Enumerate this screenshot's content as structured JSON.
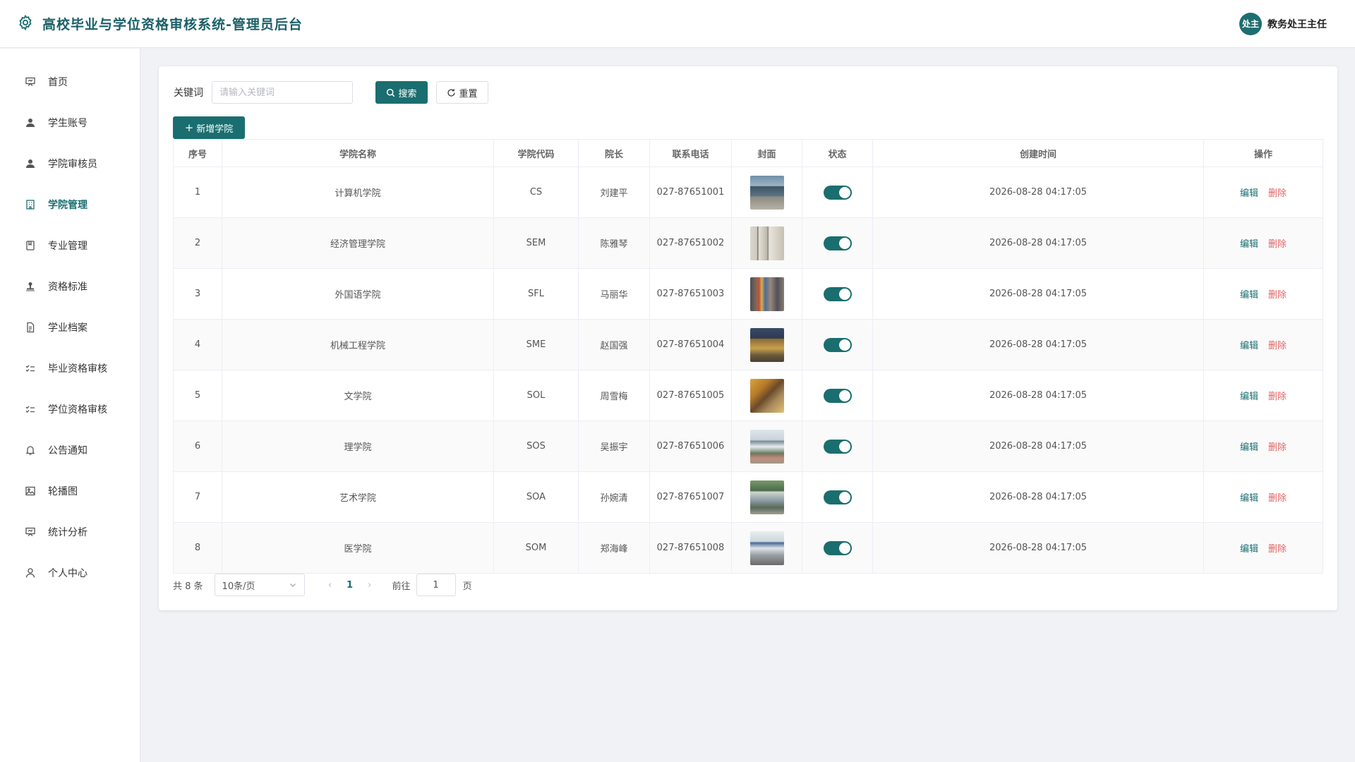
{
  "header": {
    "title": "高校毕业与学位资格审核系统-管理员后台",
    "avatar_text": "处主",
    "user_name": "教务处王主任"
  },
  "sidebar": {
    "items": [
      {
        "label": "首页",
        "icon": "presentation-icon",
        "active": false
      },
      {
        "label": "学生账号",
        "icon": "user-icon",
        "active": false
      },
      {
        "label": "学院审核员",
        "icon": "user-icon",
        "active": false
      },
      {
        "label": "学院管理",
        "icon": "building-icon",
        "active": true
      },
      {
        "label": "专业管理",
        "icon": "notebook-icon",
        "active": false
      },
      {
        "label": "资格标准",
        "icon": "stamp-icon",
        "active": false
      },
      {
        "label": "学业档案",
        "icon": "document-icon",
        "active": false
      },
      {
        "label": "毕业资格审核",
        "icon": "checklist-icon",
        "active": false
      },
      {
        "label": "学位资格审核",
        "icon": "checklist-icon",
        "active": false
      },
      {
        "label": "公告通知",
        "icon": "bell-icon",
        "active": false
      },
      {
        "label": "轮播图",
        "icon": "picture-icon",
        "active": false
      },
      {
        "label": "统计分析",
        "icon": "presentation-icon",
        "active": false
      },
      {
        "label": "个人中心",
        "icon": "person-outline-icon",
        "active": false
      }
    ]
  },
  "search": {
    "label": "关键词",
    "placeholder": "请输入关键词",
    "value": "",
    "search_label": "搜索",
    "reset_label": "重置"
  },
  "toolbar": {
    "add_label": "新增学院"
  },
  "table": {
    "headers": [
      "序号",
      "学院名称",
      "学院代码",
      "院长",
      "联系电话",
      "封面",
      "状态",
      "创建时间",
      "操作"
    ],
    "edit_label": "编辑",
    "delete_label": "删除",
    "rows": [
      {
        "index": "1",
        "name": "计算机学院",
        "code": "CS",
        "dean": "刘建平",
        "phone": "027-87651001",
        "status_on": true,
        "created": "2026-08-28 04:17:05"
      },
      {
        "index": "2",
        "name": "经济管理学院",
        "code": "SEM",
        "dean": "陈雅琴",
        "phone": "027-87651002",
        "status_on": true,
        "created": "2026-08-28 04:17:05"
      },
      {
        "index": "3",
        "name": "外国语学院",
        "code": "SFL",
        "dean": "马丽华",
        "phone": "027-87651003",
        "status_on": true,
        "created": "2026-08-28 04:17:05"
      },
      {
        "index": "4",
        "name": "机械工程学院",
        "code": "SME",
        "dean": "赵国强",
        "phone": "027-87651004",
        "status_on": true,
        "created": "2026-08-28 04:17:05"
      },
      {
        "index": "5",
        "name": "文学院",
        "code": "SOL",
        "dean": "周雪梅",
        "phone": "027-87651005",
        "status_on": true,
        "created": "2026-08-28 04:17:05"
      },
      {
        "index": "6",
        "name": "理学院",
        "code": "SOS",
        "dean": "吴振宇",
        "phone": "027-87651006",
        "status_on": true,
        "created": "2026-08-28 04:17:05"
      },
      {
        "index": "7",
        "name": "艺术学院",
        "code": "SOA",
        "dean": "孙婉清",
        "phone": "027-87651007",
        "status_on": true,
        "created": "2026-08-28 04:17:05"
      },
      {
        "index": "8",
        "name": "医学院",
        "code": "SOM",
        "dean": "郑海峰",
        "phone": "027-87651008",
        "status_on": true,
        "created": "2026-08-28 04:17:05"
      }
    ]
  },
  "pagination": {
    "total_text": "共 8 条",
    "page_size": "10条/页",
    "current_page": "1",
    "goto_label": "前往",
    "goto_value": "1",
    "unit_label": "页"
  },
  "colors": {
    "primary": "#1a6e6f",
    "danger": "#e06464"
  }
}
